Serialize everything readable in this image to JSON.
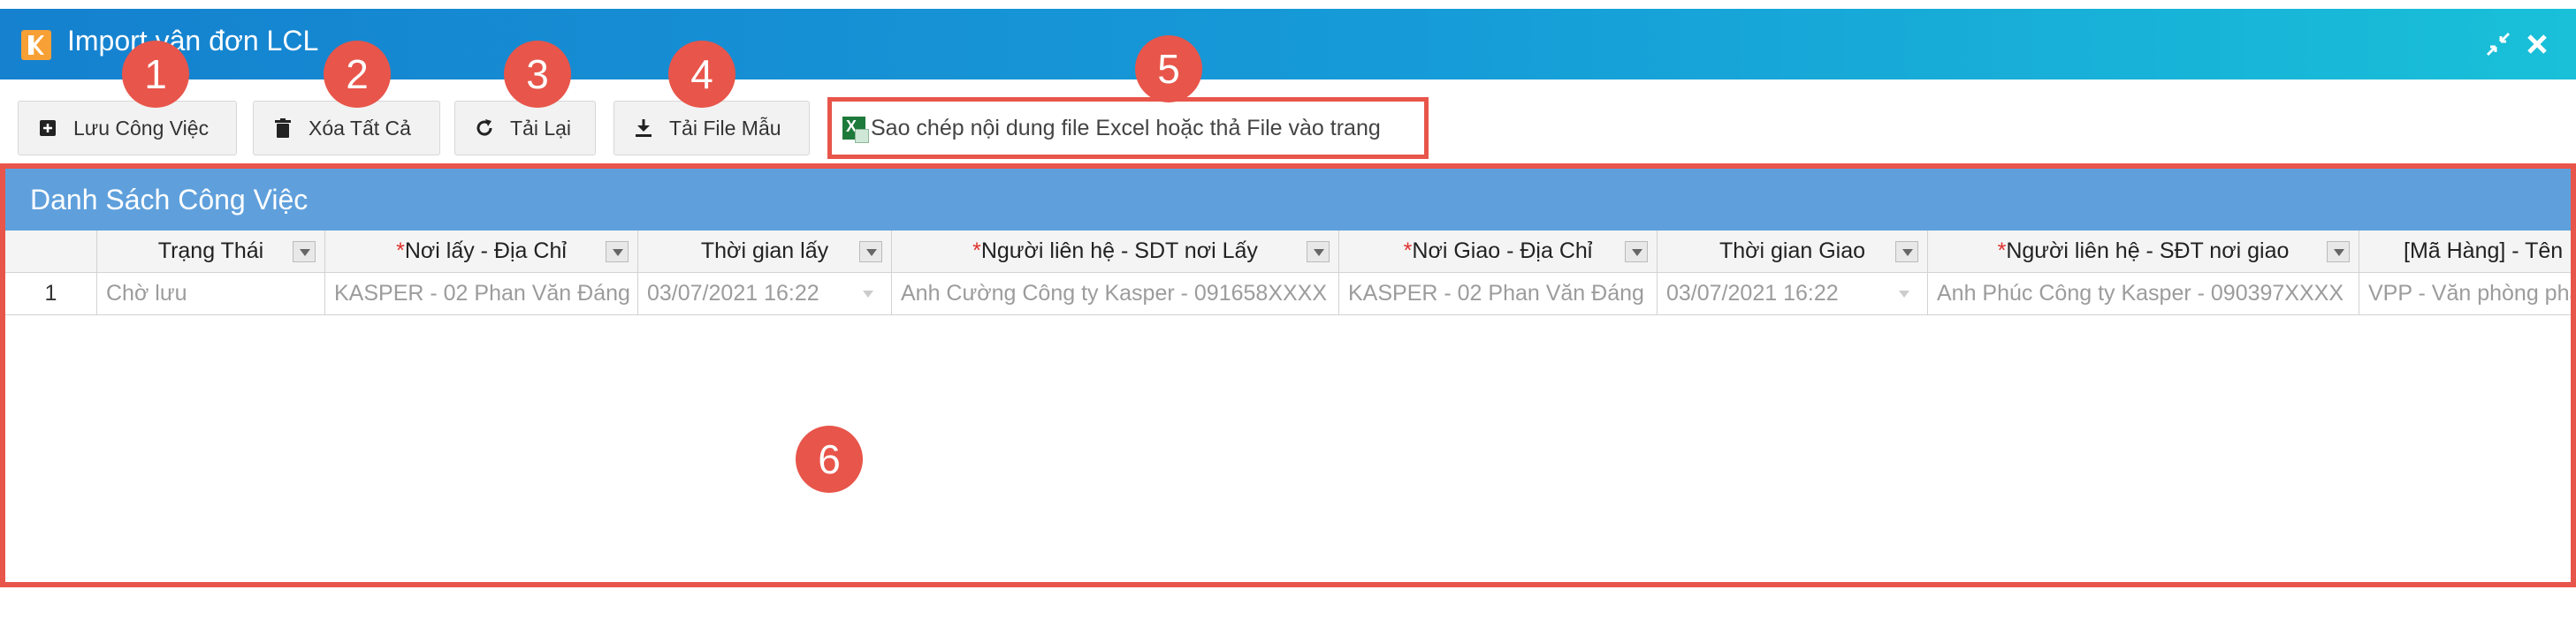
{
  "window": {
    "title": "Import vận đơn LCL"
  },
  "toolbar": {
    "buttons": [
      {
        "label": "Lưu Công Việc",
        "icon": "plus-square-icon"
      },
      {
        "label": "Xóa Tất Cả",
        "icon": "trash-icon"
      },
      {
        "label": "Tải Lại",
        "icon": "refresh-icon"
      },
      {
        "label": "Tải File Mẫu",
        "icon": "download-icon"
      }
    ],
    "paste_hint": "Sao chép nội dung file Excel hoặc thả File vào trang"
  },
  "panel": {
    "title": "Danh Sách Công Việc"
  },
  "grid": {
    "columns": [
      {
        "label": "Trạng Thái",
        "required": false
      },
      {
        "label": "Nơi lấy - Địa Chỉ",
        "required": true
      },
      {
        "label": "Thời gian lấy",
        "required": false
      },
      {
        "label": "Người liên hệ - SDT nơi Lấy",
        "required": true
      },
      {
        "label": "Nơi Giao - Địa Chỉ",
        "required": true
      },
      {
        "label": "Thời gian Giao",
        "required": false
      },
      {
        "label": "Người liên hệ - SĐT nơi giao",
        "required": true
      },
      {
        "label": "[Mã Hàng] - Tên Hàng",
        "required": false
      }
    ],
    "rows": [
      {
        "index": "1",
        "cells": [
          "Chờ lưu",
          "KASPER - 02 Phan Văn Đáng",
          "03/07/2021 16:22",
          "Anh Cường Công ty Kasper - 091658XXXX",
          "KASPER - 02 Phan Văn Đáng",
          "03/07/2021 16:22",
          "Anh Phúc Công ty Kasper - 090397XXXX",
          "VPP - Văn phòng phẩm"
        ]
      }
    ]
  },
  "annotations": [
    "1",
    "2",
    "3",
    "4",
    "5",
    "6"
  ],
  "colors": {
    "titlebar_start": "#1581cf",
    "titlebar_end": "#19c0d8",
    "panel_header": "#5fa0dc",
    "annotation": "#e8554a",
    "required_star": "#e0302b"
  }
}
